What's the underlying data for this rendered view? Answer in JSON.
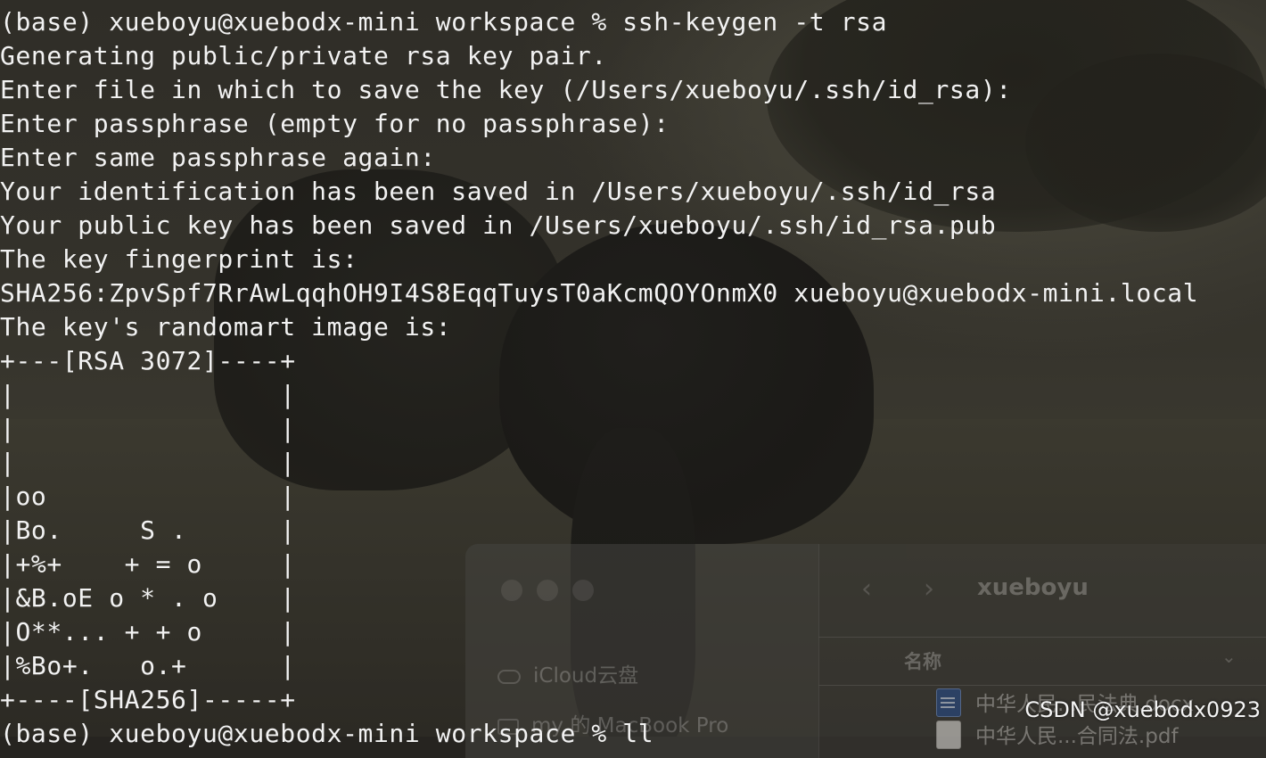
{
  "terminal": {
    "lines": [
      "(base) xueboyu@xuebodx-mini workspace % ssh-keygen -t rsa",
      "Generating public/private rsa key pair.",
      "Enter file in which to save the key (/Users/xueboyu/.ssh/id_rsa):",
      "Enter passphrase (empty for no passphrase):",
      "Enter same passphrase again:",
      "Your identification has been saved in /Users/xueboyu/.ssh/id_rsa",
      "Your public key has been saved in /Users/xueboyu/.ssh/id_rsa.pub",
      "The key fingerprint is:",
      "SHA256:ZpvSpf7RrAwLqqhOH9I4S8EqqTuysT0aKcmQOYOnmX0 xueboyu@xuebodx-mini.local",
      "The key's randomart image is:",
      "+---[RSA 3072]----+",
      "|                 |",
      "|                 |",
      "|                 |",
      "|oo               |",
      "|Bo.     S .      |",
      "|+%+    + = o     |",
      "|&B.oE o * . o    |",
      "|O**... + + o     |",
      "|%Bo+.   o.+      |",
      "+----[SHA256]-----+",
      "(base) xueboyu@xuebodx-mini workspace % ll"
    ]
  },
  "finder": {
    "title": "xueboyu",
    "nav_back": "‹",
    "nav_forward": "›",
    "sidebar": [
      {
        "label": "iCloud云盘",
        "icon": "cloud-icon"
      },
      {
        "label": "my 的 MacBook Pro",
        "icon": "laptop-icon"
      }
    ],
    "column_header": "名称",
    "sort_chevron": "⌄",
    "files": [
      {
        "name": "中华人民...民法典.docx",
        "icon": "word-doc-icon"
      },
      {
        "name": "中华人民...合同法.pdf",
        "icon": "pdf-icon"
      }
    ]
  },
  "watermark": "CSDN @xuebodx0923"
}
